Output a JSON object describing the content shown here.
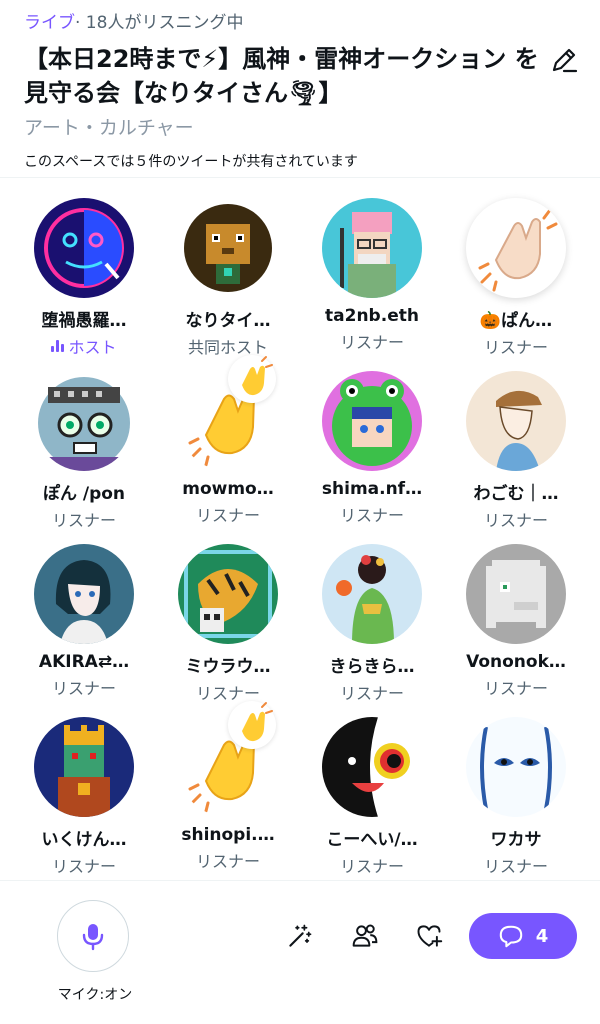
{
  "header": {
    "live_label": "ライブ",
    "listening_text": "· 18人がリスニング中",
    "title": "【本日22時まで⚡】風神・雷神オークション を見守る会【なりタイさん🌪】",
    "category": "アート・カルチャー",
    "shared_tweets": "このスペースでは５件のツイートが共有されています"
  },
  "participants": [
    {
      "name": "堕禍愚羅…",
      "role": "ホスト",
      "avatar": "neon-face-avatar"
    },
    {
      "name": "なりタイ…",
      "role": "共同ホスト",
      "avatar": "pixel-lion-avatar"
    },
    {
      "name": "ta2nb.eth",
      "role": "リスナー",
      "avatar": "pixel-elder-avatar"
    },
    {
      "name": "🎃ぱん…",
      "role": "リスナー",
      "avatar": "clap-reaction"
    },
    {
      "name": "ぽん /pon",
      "role": "リスナー",
      "avatar": "pixel-robot-avatar"
    },
    {
      "name": "mowmo…",
      "role": "リスナー",
      "avatar": "clap-reaction"
    },
    {
      "name": "shima.nf…",
      "role": "リスナー",
      "avatar": "frog-hood-avatar"
    },
    {
      "name": "わごむ｜…",
      "role": "リスナー",
      "avatar": "cap-boy-avatar"
    },
    {
      "name": "AKIRA⇄…",
      "role": "リスナー",
      "avatar": "anime-girl-avatar"
    },
    {
      "name": "ミウラウ…",
      "role": "リスナー",
      "avatar": "tiger-skull-avatar"
    },
    {
      "name": "きらきら…",
      "role": "リスナー",
      "avatar": "kimono-avatar"
    },
    {
      "name": "Vononok…",
      "role": "リスナー",
      "avatar": "pixel-ghost-avatar"
    },
    {
      "name": "いくけん…",
      "role": "リスナー",
      "avatar": "pixel-king-avatar"
    },
    {
      "name": "shinopi.…",
      "role": "リスナー",
      "avatar": "clap-reaction"
    },
    {
      "name": "こーへい/…",
      "role": "リスナー",
      "avatar": "mask-face-avatar"
    },
    {
      "name": "ワカサ",
      "role": "リスナー",
      "avatar": "blue-eyes-avatar"
    }
  ],
  "footer": {
    "mic_label": "マイク:オン",
    "chat_count": "4"
  },
  "colors": {
    "accent": "#7856ff",
    "muted": "#536471"
  }
}
